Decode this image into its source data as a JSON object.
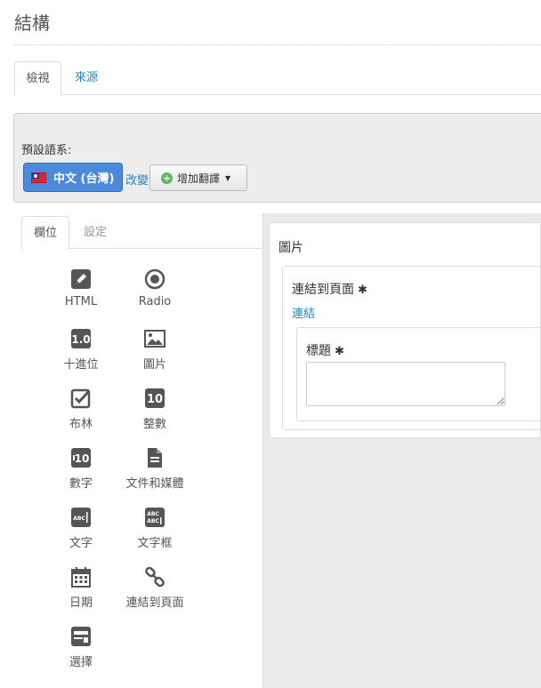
{
  "page": {
    "title": "結構"
  },
  "top_tabs": [
    {
      "label": "檢視",
      "active": true
    },
    {
      "label": "來源",
      "active": false
    }
  ],
  "language": {
    "label": "預設語系:",
    "current": "中文 (台灣)",
    "change_link": "改變",
    "add_translation": "增加翻譯"
  },
  "palette": {
    "tabs": [
      {
        "label": "欄位",
        "active": true
      },
      {
        "label": "設定",
        "active": false
      }
    ],
    "fields": [
      {
        "label": "HTML",
        "icon": "pencil-icon"
      },
      {
        "label": "Radio",
        "icon": "radio-icon"
      },
      {
        "label": "十進位",
        "icon": "decimal-icon"
      },
      {
        "label": "圖片",
        "icon": "image-icon"
      },
      {
        "label": "布林",
        "icon": "checkbox-icon"
      },
      {
        "label": "整數",
        "icon": "integer-icon"
      },
      {
        "label": "數字",
        "icon": "number-icon"
      },
      {
        "label": "文件和媒體",
        "icon": "document-icon"
      },
      {
        "label": "文字",
        "icon": "text-icon"
      },
      {
        "label": "文字框",
        "icon": "textbox-icon"
      },
      {
        "label": "日期",
        "icon": "calendar-icon"
      },
      {
        "label": "連結到頁面",
        "icon": "link-icon"
      },
      {
        "label": "選擇",
        "icon": "select-icon"
      }
    ]
  },
  "canvas": {
    "image_field": {
      "title": "圖片"
    },
    "link_field": {
      "title": "連結到頁面",
      "required_mark": "✱",
      "link_text": "連結"
    },
    "caption_field": {
      "title": "標題",
      "required_mark": "✱",
      "value": ""
    }
  },
  "colors": {
    "accent": "#1e88c7",
    "language_button": "#4a89dc",
    "canvas_bg": "#eaeaea"
  }
}
